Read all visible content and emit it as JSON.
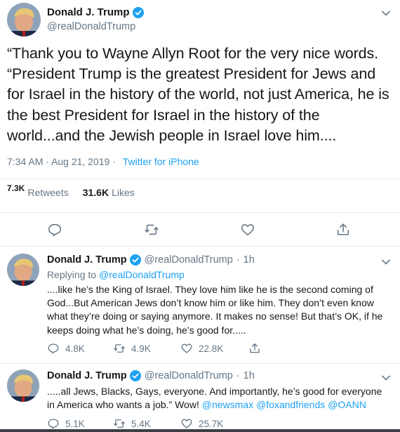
{
  "main_tweet": {
    "display_name": "Donald J. Trump",
    "handle": "@realDonaldTrump",
    "text": "“Thank you to Wayne Allyn Root for the very nice words. “President Trump is the greatest President for Jews and for Israel in the history of the world, not just America, he is the best President for Israel in the history of the world...and the Jewish people in Israel love him....",
    "timestamp": "7:34 AM · Aug 21, 2019 ·",
    "source": "Twitter for iPhone",
    "retweets_count": "7.3K",
    "retweets_label": "Retweets",
    "likes_count": "31.6K",
    "likes_label": "Likes"
  },
  "replies": [
    {
      "display_name": "Donald J. Trump",
      "handle": "@realDonaldTrump",
      "time": "1h",
      "replying_label": "Replying to",
      "replying_to": "@realDonaldTrump",
      "text": "....like he’s the King of Israel. They love him like he is the second coming of God...But American Jews don’t know him or like him. They don’t even know what they’re doing or saying anymore. It makes no sense! But that’s OK, if he keeps doing what he’s doing, he’s good for.....",
      "replies": "4.8K",
      "retweets": "4.9K",
      "likes": "22.8K"
    },
    {
      "display_name": "Donald J. Trump",
      "handle": "@realDonaldTrump",
      "time": "1h",
      "text": ".....all Jews, Blacks, Gays, everyone. And importantly, he’s good for everyone in America who wants a job.” Wow!",
      "mentions": [
        "@newsmax",
        "@foxandfriends",
        "@OANN"
      ],
      "replies": "5.1K",
      "retweets": "5.4K",
      "likes": "25.7K"
    }
  ],
  "colors": {
    "accent": "#1da1f2",
    "secondary_text": "#657786",
    "primary_text": "#14171a",
    "divider": "#e6ecf0"
  },
  "icons": [
    "verified-badge-icon",
    "chevron-down-icon",
    "reply-icon",
    "retweet-icon",
    "like-icon",
    "share-icon"
  ]
}
